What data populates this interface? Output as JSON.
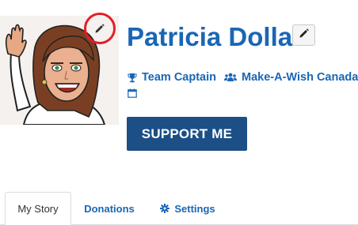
{
  "profile": {
    "name": "Patricia Dolla",
    "role": "Team Captain",
    "organization": "Make-A-Wish Canada"
  },
  "actions": {
    "support_label": "SUPPORT ME"
  },
  "tabs": [
    {
      "label": "My Story",
      "active": true
    },
    {
      "label": "Donations",
      "active": false
    },
    {
      "label": "Settings",
      "active": false,
      "icon": "gear-icon"
    }
  ],
  "icons": {
    "avatar_edit": "pencil-icon",
    "name_edit": "pencil-icon",
    "role": "trophy-icon",
    "organization": "group-icon",
    "date": "calendar-icon"
  },
  "colors": {
    "accent": "#1a66b5",
    "button": "#1b4f86",
    "highlight_circle": "#e41e26"
  }
}
